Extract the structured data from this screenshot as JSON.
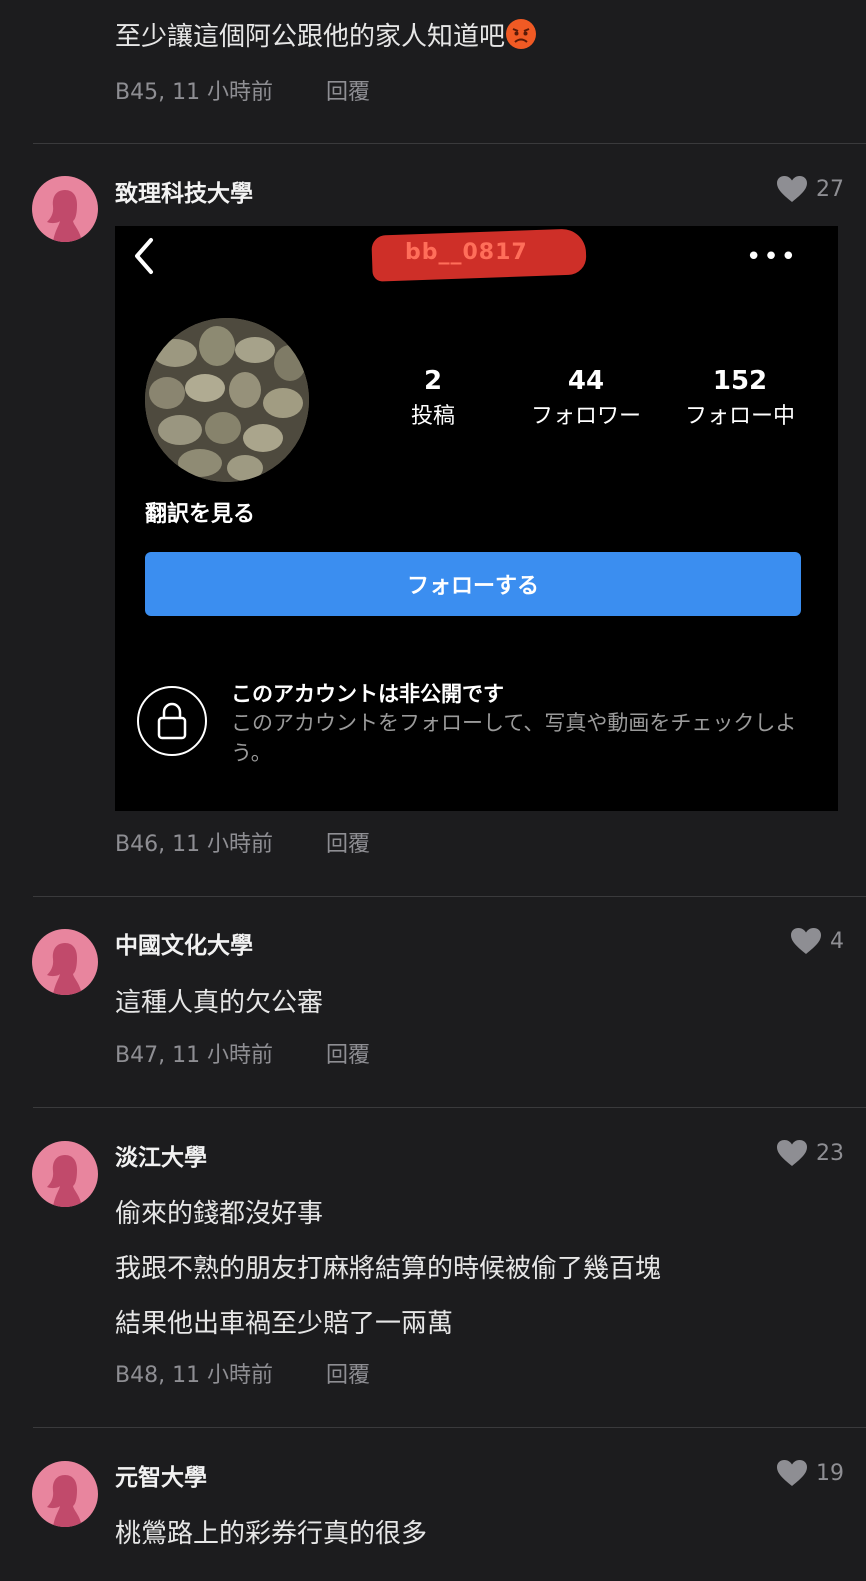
{
  "colors": {
    "background": "#1c1c1e",
    "avatar": "#e8859e",
    "follow_button": "#3b8ef0",
    "redaction": "#d9312a"
  },
  "top_comment": {
    "text": "至少讓這個阿公跟他的家人知道吧",
    "emoji": "angry-face-emoji",
    "meta": "B45, 11 小時前",
    "reply": "回覆"
  },
  "comments": [
    {
      "user": "致理科技大學",
      "likes": "27",
      "meta": "B46, 11 小時前",
      "reply": "回覆",
      "image": {
        "handle": "bb__0817",
        "stats": [
          {
            "num": "2",
            "label": "投稿"
          },
          {
            "num": "44",
            "label": "フォロワー"
          },
          {
            "num": "152",
            "label": "フォロー中"
          }
        ],
        "translate": "翻訳を見る",
        "follow_button": "フォローする",
        "private_title": "このアカウントは非公開です",
        "private_desc": "このアカウントをフォローして、写真や動画をチェックしよう。"
      }
    },
    {
      "user": "中國文化大學",
      "likes": "4",
      "lines": [
        "這種人真的欠公審"
      ],
      "meta": "B47, 11 小時前",
      "reply": "回覆"
    },
    {
      "user": "淡江大學",
      "likes": "23",
      "lines": [
        "偷來的錢都沒好事",
        "我跟不熟的朋友打麻將結算的時候被偷了幾百塊",
        "結果他出車禍至少賠了一兩萬"
      ],
      "meta": "B48, 11 小時前",
      "reply": "回覆"
    },
    {
      "user": "元智大學",
      "likes": "19",
      "lines": [
        "桃鶯路上的彩券行真的很多"
      ]
    }
  ]
}
